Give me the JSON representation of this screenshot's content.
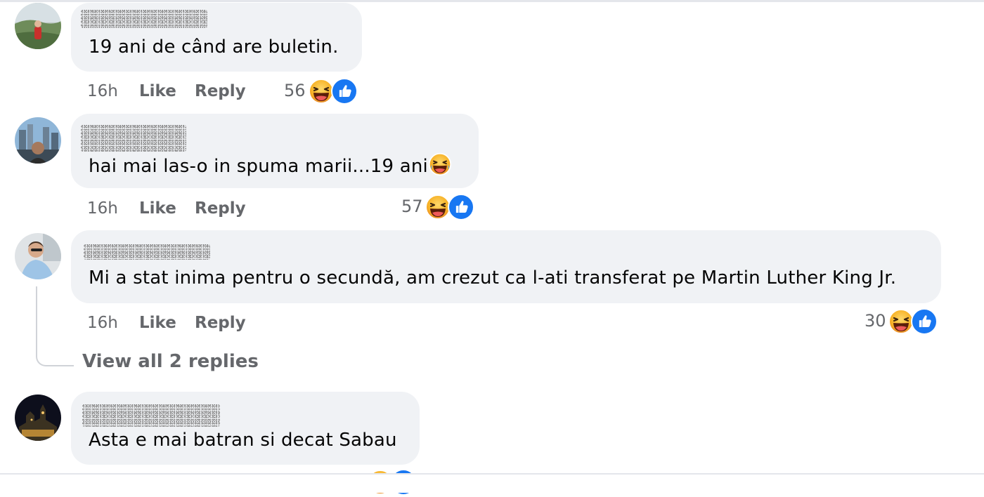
{
  "comments": [
    {
      "text": "19 ani de când are buletin.",
      "time": "16h",
      "like_label": "Like",
      "reply_label": "Reply",
      "reaction_count": "56",
      "reactions": [
        "haha-icon",
        "like-icon"
      ]
    },
    {
      "text": "hai mai las-o in spuma marii...19 ani",
      "inline_emoji": "laughing-tears-emoji",
      "time": "16h",
      "like_label": "Like",
      "reply_label": "Reply",
      "reaction_count": "57",
      "reactions": [
        "haha-icon",
        "like-icon"
      ]
    },
    {
      "text": "Mi a stat inima pentru o secundă, am crezut ca l-ati transferat pe Martin Luther King Jr.",
      "time": "16h",
      "like_label": "Like",
      "reply_label": "Reply",
      "reaction_count": "30",
      "reactions": [
        "haha-icon",
        "like-icon"
      ],
      "view_replies": "View all 2 replies"
    },
    {
      "text": "Asta e mai batran si decat Sabau",
      "reactions": [
        "haha-icon",
        "like-icon"
      ]
    }
  ],
  "colors": {
    "bubble": "#f0f2f5",
    "meta_text": "#65676b",
    "like_blue": "#1877f2",
    "haha_yellow": "#f7b125"
  }
}
